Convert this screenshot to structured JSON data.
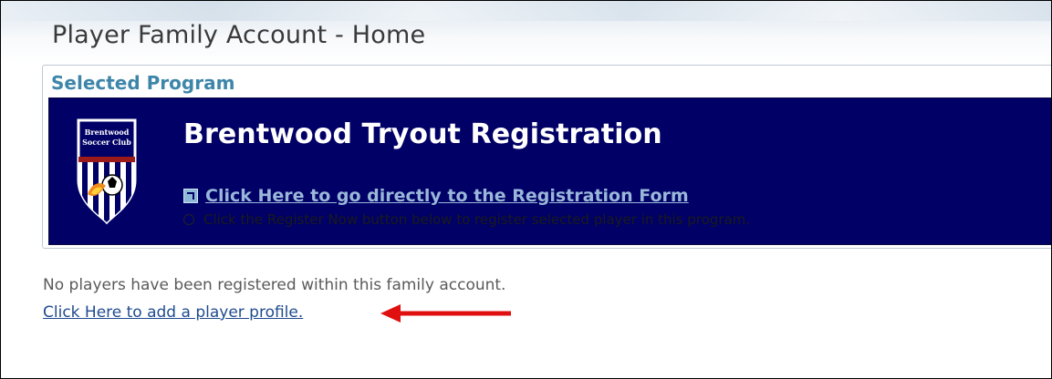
{
  "page": {
    "title": "Player Family Account - Home"
  },
  "selected_program": {
    "heading": "Selected Program",
    "program_name": "Brentwood Tryout Registration",
    "registration_link": "Click Here to go directly to the Registration Form",
    "hint": "Click the Register Now button below to register selected player in this program.",
    "crest_text": "Brentwood Soccer Club",
    "banner_color": "#000066"
  },
  "players": {
    "empty_message": "No players have been registered within this family account.",
    "add_link": "Click Here to add a player profile."
  },
  "annotation": {
    "arrow_color": "#e01010",
    "arrow_icon": "left-arrow-icon"
  }
}
